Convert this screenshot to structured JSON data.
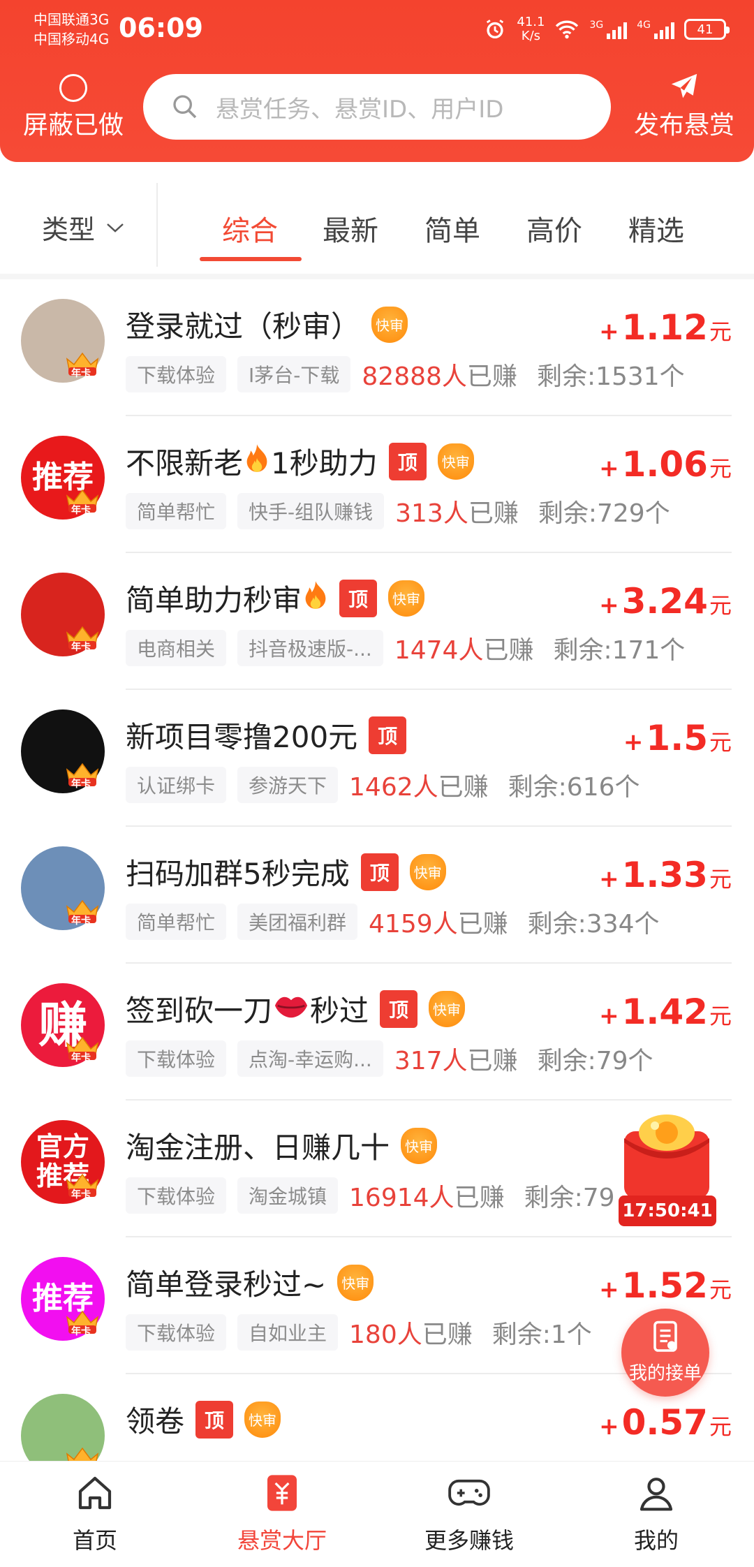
{
  "status_bar": {
    "carrier1": "中国联通3G",
    "carrier2": "中国移动4G",
    "time": "06:09",
    "net_speed_value": "41.1",
    "net_speed_unit": "K/s",
    "sig1_label": "3G",
    "sig2_label": "4G",
    "battery": "41"
  },
  "header": {
    "shield_label": "屏蔽已做",
    "search_placeholder": "悬赏任务、悬赏ID、用户ID",
    "publish_label": "发布悬赏"
  },
  "tabs": {
    "type_label": "类型",
    "items": [
      "综合",
      "最新",
      "简单",
      "高价",
      "精选"
    ],
    "active": "综合"
  },
  "colors": {
    "brand": "#f4432e",
    "price": "#f32b25",
    "fast_badge": "#ff9a1a",
    "top_badge": "#ee3d32"
  },
  "tasks": [
    {
      "title": "登录就过（秒审）",
      "fire": false,
      "lips": false,
      "top": false,
      "fast": true,
      "tag1": "下载体验",
      "tag2": "I茅台-下载",
      "earned_count": "82888人",
      "earned_suffix": "已赚",
      "remain": "剩余:1531个",
      "price": "1.12",
      "avatar_text": "",
      "avatar_color": "#c9b8a8",
      "crown": "年卡"
    },
    {
      "title": "不限新老",
      "title_after": "1秒助力",
      "fire": true,
      "lips": false,
      "top": true,
      "fast": true,
      "tag1": "简单帮忙",
      "tag2": "快手-组队赚钱",
      "earned_count": "313人",
      "earned_suffix": "已赚",
      "remain": "剩余:729个",
      "price": "1.06",
      "avatar_text": "推荐",
      "avatar_color": "#e8191b",
      "crown": "年卡"
    },
    {
      "title": "简单助力秒审",
      "fire": true,
      "lips": false,
      "top": true,
      "fast": true,
      "tag1": "电商相关",
      "tag2": "抖音极速版-...",
      "earned_count": "1474人",
      "earned_suffix": "已赚",
      "remain": "剩余:171个",
      "price": "3.24",
      "avatar_text": "",
      "avatar_color": "#d8241e",
      "crown": "年卡"
    },
    {
      "title": "新项目零撸200元",
      "fire": false,
      "lips": false,
      "top": true,
      "fast": false,
      "tag1": "认证绑卡",
      "tag2": "参游天下",
      "earned_count": "1462人",
      "earned_suffix": "已赚",
      "remain": "剩余:616个",
      "price": "1.5",
      "avatar_text": "",
      "avatar_color": "#111111",
      "crown": "年卡"
    },
    {
      "title": "扫码加群5秒完成",
      "fire": false,
      "lips": false,
      "top": true,
      "fast": true,
      "tag1": "简单帮忙",
      "tag2": "美团福利群",
      "earned_count": "4159人",
      "earned_suffix": "已赚",
      "remain": "剩余:334个",
      "price": "1.33",
      "avatar_text": "",
      "avatar_color": "#6d8fb8",
      "crown": "年卡"
    },
    {
      "title": "签到砍一刀",
      "title_after": "秒过",
      "fire": false,
      "lips": true,
      "top": true,
      "fast": true,
      "tag1": "下载体验",
      "tag2": "点淘-幸运购...",
      "earned_count": "317人",
      "earned_suffix": "已赚",
      "remain": "剩余:79个",
      "price": "1.42",
      "avatar_text": "赚",
      "avatar_color": "#ec1b3c",
      "crown": "年卡"
    },
    {
      "title": "淘金注册、日赚几十",
      "fire": false,
      "lips": false,
      "top": false,
      "fast": true,
      "tag1": "下载体验",
      "tag2": "淘金城镇",
      "earned_count": "16914人",
      "earned_suffix": "已赚",
      "remain": "剩余:79",
      "price": "",
      "avatar_text": "官方推荐",
      "avatar_color": "#e3181c",
      "crown": "年卡"
    },
    {
      "title": "简单登录秒过~",
      "fire": false,
      "lips": false,
      "top": false,
      "fast": true,
      "tag1": "下载体验",
      "tag2": "自如业主",
      "earned_count": "180人",
      "earned_suffix": "已赚",
      "remain": "剩余:1个",
      "price": "1.52",
      "avatar_text": "推荐",
      "avatar_color": "#f20ff0",
      "crown": "年卡"
    },
    {
      "title": "领卷",
      "fire": false,
      "lips": false,
      "top": true,
      "fast": true,
      "tag1": "",
      "tag2": "",
      "earned_count": "",
      "earned_suffix": "",
      "remain": "",
      "price": "0.57",
      "avatar_text": "",
      "avatar_color": "#8fbf7a",
      "crown": "年卡"
    }
  ],
  "badges": {
    "top": "顶",
    "fast": "快审",
    "plus": "+",
    "unit": "元"
  },
  "floating": {
    "timer": "17:50:41",
    "my_orders": "我的接单"
  },
  "bottom_nav": [
    {
      "label": "首页",
      "icon": "home-icon"
    },
    {
      "label": "悬赏大厅",
      "icon": "reward-hall-icon"
    },
    {
      "label": "更多赚钱",
      "icon": "gamepad-icon"
    },
    {
      "label": "我的",
      "icon": "user-icon"
    }
  ]
}
